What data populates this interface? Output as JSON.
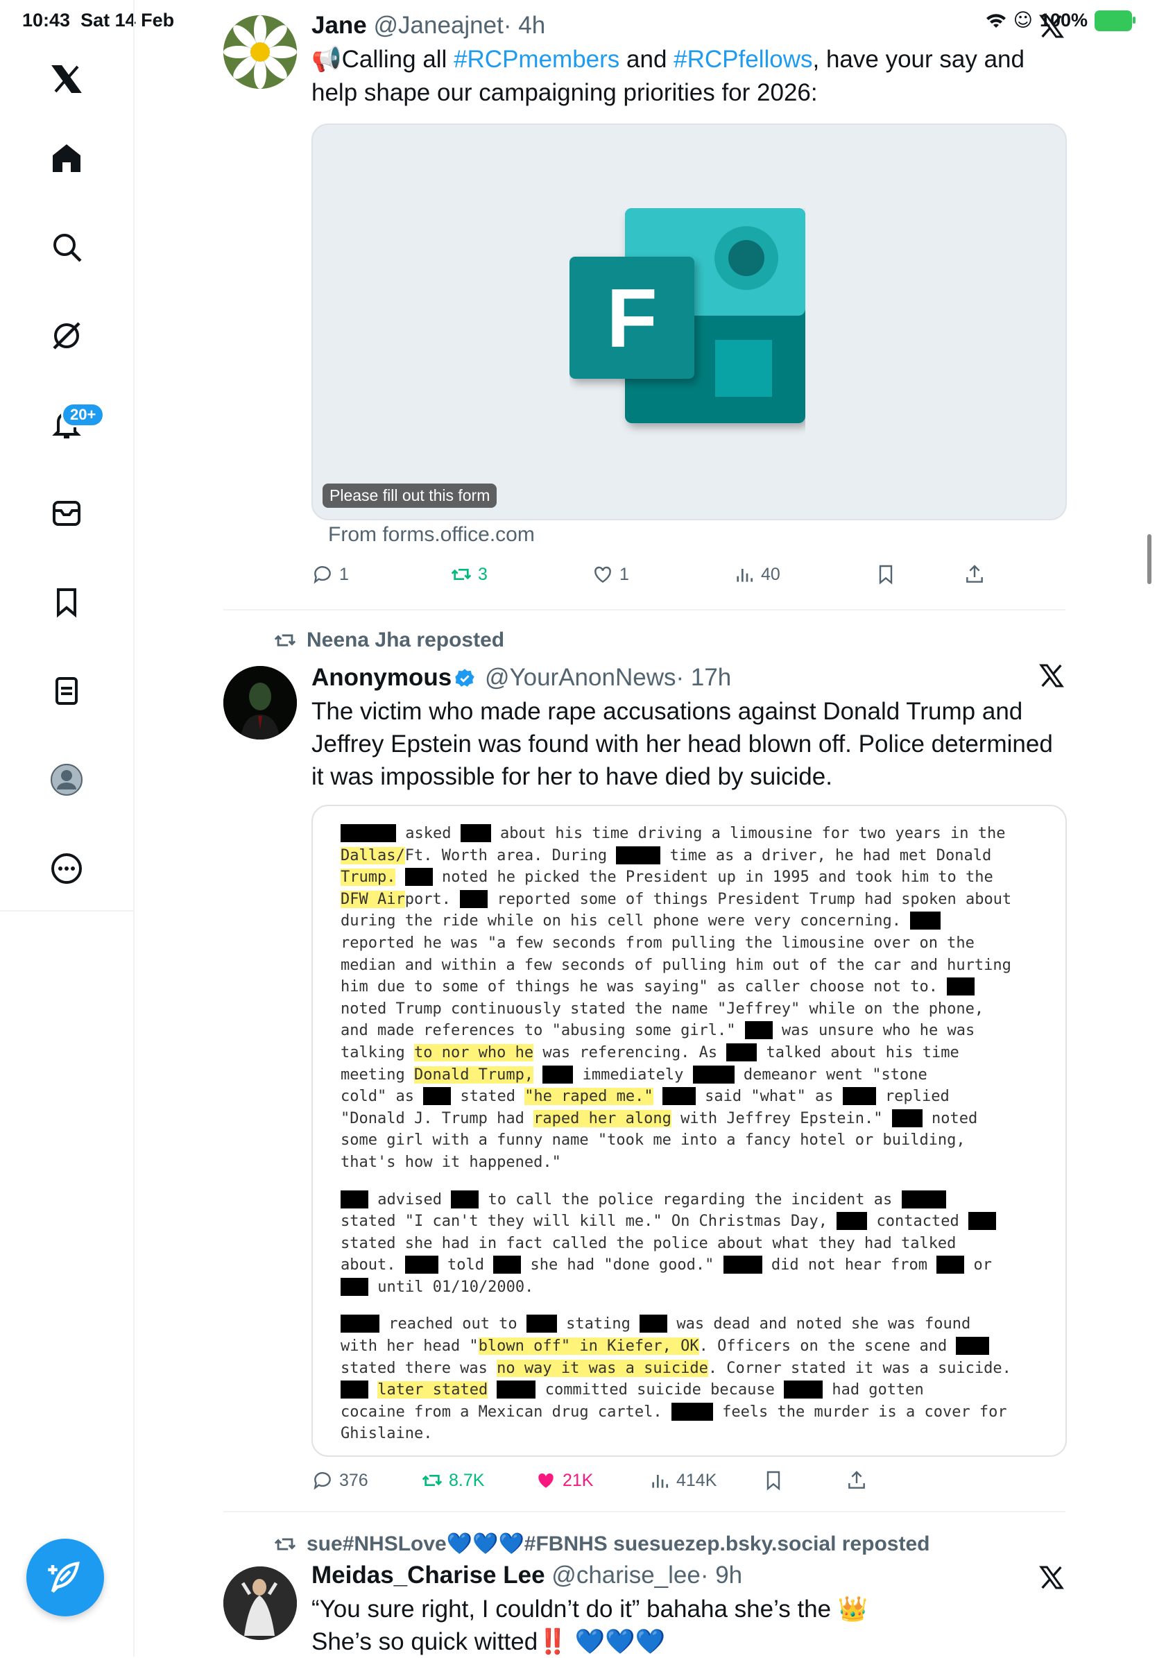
{
  "status": {
    "time": "10:43",
    "date": "Sat 14 Feb",
    "battery": "100%"
  },
  "sidebar": {
    "items": [
      "logo-x-icon",
      "home-icon",
      "search-icon",
      "grok-icon",
      "notifications-icon",
      "messages-icon",
      "bookmarks-icon",
      "lists-icon",
      "profile-icon",
      "more-icon"
    ],
    "notification_badge": "20+"
  },
  "tweet1": {
    "name": "Jane",
    "handle": "@Janeajnet",
    "time": "· 4h",
    "body_pre": "Calling all ",
    "tag1": "#RCPmembers",
    "body_mid": " and ",
    "tag2": "#RCPfellows",
    "body_post": ", have your say and help shape our campaigning priorities for 2026:",
    "card_caption": "Please fill out this form",
    "card_source": "From forms.office.com",
    "replies": "1",
    "reposts": "3",
    "likes": "1",
    "views": "40"
  },
  "tweet2": {
    "reposted_by": "Neena Jha reposted",
    "name": "Anonymous",
    "handle": "@YourAnonNews",
    "time": "· 17h",
    "body": "The victim who made rape accusations against Donald Trump and Jeffrey Epstein was found with her head blown off. Police determined it was impossible for her to have died by suicide.",
    "replies": "376",
    "reposts": "8.7K",
    "likes": "21K",
    "views": "414K",
    "doc": {
      "p1": [
        [
          "",
          " asked ",
          " about his time driving a limousine for two years in the"
        ],
        [
          "Dallas/Ft. Worth area. During ",
          " time as a driver, he had met Donald"
        ],
        [
          "Trump. ",
          " noted he picked the President up in 1995 and took him to the"
        ],
        [
          "DFW Airport. ",
          " reported some of things President Trump had spoken about"
        ],
        [
          "during the ride while on his cell phone were very concerning. "
        ],
        [
          "reported he was \"a few seconds from pulling the limousine over on the"
        ],
        [
          "median and within a few seconds of pulling him out of the car and hurting"
        ],
        [
          "him due to some of things he was saying\" as caller choose not to. "
        ],
        [
          "noted Trump continuously stated the name \"Jeffrey\" while on the phone,"
        ],
        [
          "and made references to \"abusing some girl.\" ",
          " was unsure who he was"
        ],
        [
          "talking to nor who he was referencing. As ",
          " talked about his time"
        ],
        [
          "meeting Donald Trump, ",
          " immediately ",
          " demeanor went \"stone"
        ],
        [
          "cold\" as ",
          " stated \"he raped me.\" ",
          " said \"what\" as ",
          " replied"
        ],
        [
          "\"Donald J. Trump had raped her along with Jeffrey Epstein.\" ",
          " noted"
        ],
        [
          "some girl with a funny name \"took me into a fancy hotel or building,"
        ],
        [
          "that's how it happened.\""
        ]
      ],
      "p2": [
        [
          "",
          " advised ",
          " to call the police regarding the incident as "
        ],
        [
          "stated \"I can't they will kill me.\" On Christmas Day, ",
          " contacted "
        ],
        [
          "stated she had in fact called the police about what they had talked"
        ],
        [
          "about. ",
          " told ",
          " she had \"done good.\" ",
          " did not hear from ",
          " or"
        ],
        [
          "",
          " until 01/10/2000."
        ]
      ],
      "p3": [
        [
          "",
          " reached out to ",
          " stating ",
          " was dead and noted she was found"
        ],
        [
          "with her head \"blown off\" in Kiefer, OK. Officers on the scene and "
        ],
        [
          "stated there was no way it was a suicide. Corner stated it was a suicide."
        ],
        [
          "",
          " later stated ",
          " committed suicide because ",
          " had gotten"
        ],
        [
          "cocaine from a Mexican drug cartel. ",
          " feels the murder is a cover for"
        ],
        [
          "Ghislaine."
        ]
      ]
    }
  },
  "tweet3": {
    "reposted_by": "sue#NHSLove💙💙💙#FBNHS suesuezep.bsky.social reposted",
    "name": "Meidas_Charise Lee",
    "handle": "@charise_lee",
    "time": "· 9h",
    "line1": "“You sure right, I couldn’t do it” bahaha she’s the 👑",
    "line2": "She’s so quick witted‼️ 💙💙💙"
  },
  "colors": {
    "accent": "#1d9bf0",
    "repost": "#00ba7c",
    "like": "#f91880",
    "muted": "#536471"
  }
}
